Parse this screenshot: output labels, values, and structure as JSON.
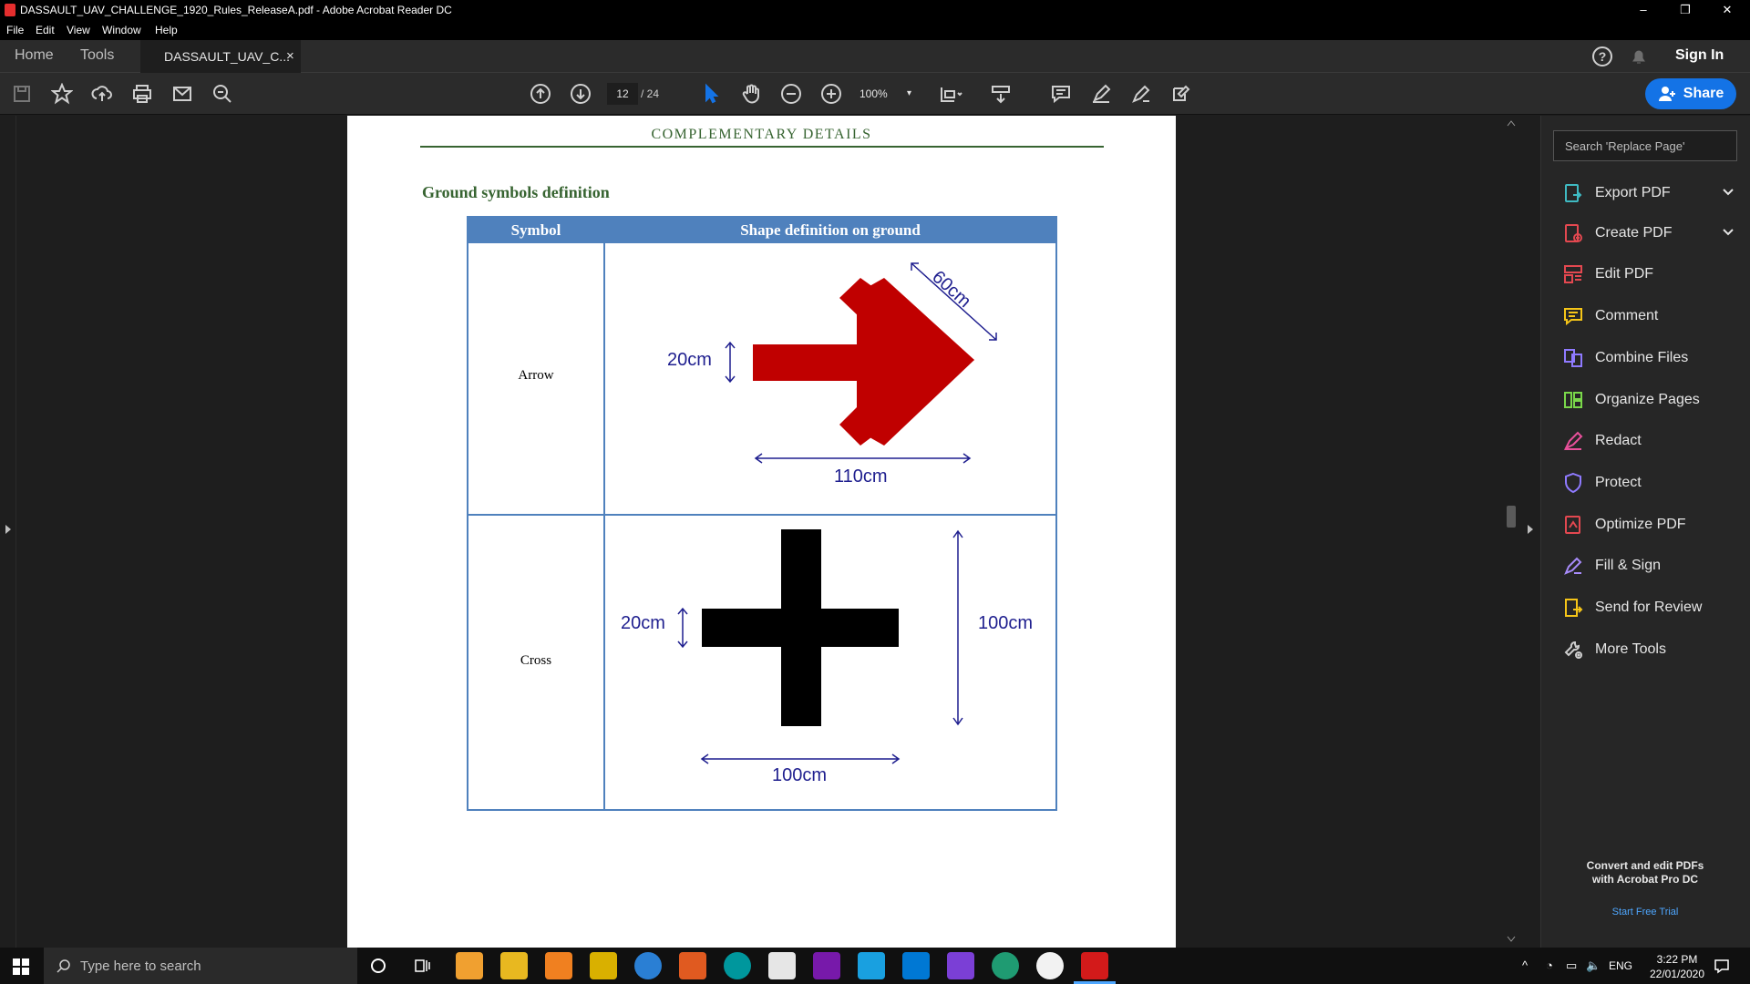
{
  "window": {
    "title": "DASSAULT_UAV_CHALLENGE_1920_Rules_ReleaseA.pdf - Adobe Acrobat Reader DC",
    "minimize": "–",
    "maximize": "❐",
    "close": "✕"
  },
  "menu": [
    "File",
    "Edit",
    "View",
    "Window",
    "Help"
  ],
  "tabs": {
    "home": "Home",
    "tools": "Tools",
    "document": "DASSAULT_UAV_C...",
    "close": "×"
  },
  "header": {
    "sign_in": "Sign In",
    "share": "Share"
  },
  "toolbar": {
    "current_page": "12",
    "total_pages": "/ 24",
    "zoom": "100%"
  },
  "document": {
    "section_header": "COMPLEMENTARY DETAILS",
    "subtitle": "Ground symbols definition",
    "table": {
      "headers": [
        "Symbol",
        "Shape definition on ground"
      ],
      "rows": [
        {
          "symbol": "Arrow",
          "dims": [
            "20cm",
            "60cm",
            "110cm"
          ]
        },
        {
          "symbol": "Cross",
          "dims": [
            "20cm",
            "100cm",
            "100cm"
          ]
        }
      ]
    },
    "colors": {
      "heading_green": "#376431",
      "table_blue": "#4f81bd",
      "arrow_red": "#c00000",
      "dim_blue": "#1f1f8f"
    }
  },
  "right_panel": {
    "search_placeholder": "Search 'Replace Page'",
    "tools": [
      {
        "label": "Export PDF",
        "icon": "export-pdf-icon",
        "color": "#3fbac2",
        "expand": true
      },
      {
        "label": "Create PDF",
        "icon": "create-pdf-icon",
        "color": "#e34850",
        "expand": true
      },
      {
        "label": "Edit PDF",
        "icon": "edit-pdf-icon",
        "color": "#e34850"
      },
      {
        "label": "Comment",
        "icon": "comment-icon",
        "color": "#f5c518"
      },
      {
        "label": "Combine Files",
        "icon": "combine-files-icon",
        "color": "#8f7aff"
      },
      {
        "label": "Organize Pages",
        "icon": "organize-pages-icon",
        "color": "#7ad84a"
      },
      {
        "label": "Redact",
        "icon": "redact-icon",
        "color": "#e9509b"
      },
      {
        "label": "Protect",
        "icon": "protect-icon",
        "color": "#8f7aff"
      },
      {
        "label": "Optimize PDF",
        "icon": "optimize-pdf-icon",
        "color": "#e34850"
      },
      {
        "label": "Fill & Sign",
        "icon": "fill-sign-icon",
        "color": "#a78bfa"
      },
      {
        "label": "Send for Review",
        "icon": "send-review-icon",
        "color": "#f5c518"
      },
      {
        "label": "More Tools",
        "icon": "more-tools-icon",
        "color": "#cfcfcf"
      }
    ],
    "promo_line1": "Convert and edit PDFs",
    "promo_line2": "with Acrobat Pro DC",
    "promo_link": "Start Free Trial"
  },
  "taskbar": {
    "search_placeholder": "Type here to search",
    "language": "ENG",
    "time": "3:22 PM",
    "date": "22/01/2020"
  }
}
